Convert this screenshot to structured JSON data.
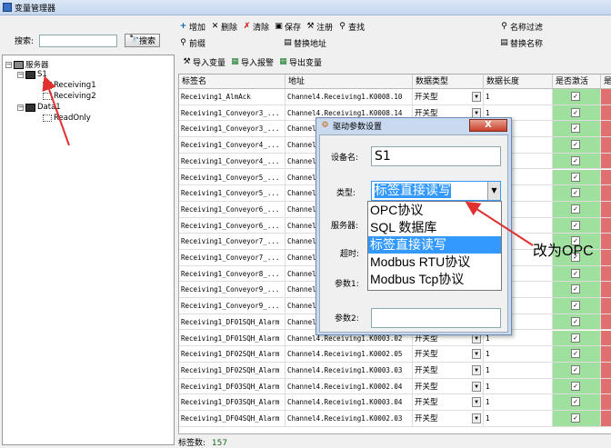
{
  "window": {
    "title": "变量管理器"
  },
  "left": {
    "search_label": "搜索:",
    "search_value": "",
    "search_button": "搜索",
    "tree": [
      {
        "label": "服务器",
        "type": "server"
      },
      {
        "label": "S1",
        "type": "device"
      },
      {
        "label": "Receiving1",
        "type": "var"
      },
      {
        "label": "Receiving2",
        "type": "var"
      },
      {
        "label": "Data1",
        "type": "device"
      },
      {
        "label": "ReadOnly",
        "type": "var"
      }
    ]
  },
  "toolbar": {
    "row1": [
      "增加",
      "删除",
      "清除",
      "保存",
      "注册",
      "查找"
    ],
    "row1_right": "名称过滤",
    "row2_left": "前缀",
    "row2_mid": "替换地址",
    "row2_right": "替换名称",
    "row3": [
      "导入变量",
      "导入报警",
      "导出变量"
    ]
  },
  "grid": {
    "columns": [
      "标签名",
      "地址",
      "数据类型",
      "数据长度",
      "是否激活",
      "是"
    ],
    "rows": [
      {
        "name": "Receiving1_AlmAck",
        "address": "Channel4.Receiving1.K0008.10",
        "dtype": "开关型",
        "len": "1",
        "active": true
      },
      {
        "name": "Receiving1_Conveyor3_...",
        "address": "Channel4.Receiving1.K0008.14",
        "dtype": "开关型",
        "len": "1",
        "active": true
      },
      {
        "name": "Receiving1_Conveyor3_...",
        "address": "Channel4",
        "dtype": "",
        "len": "",
        "active": true
      },
      {
        "name": "Receiving1_Conveyor4_...",
        "address": "Channel4",
        "dtype": "",
        "len": "",
        "active": true
      },
      {
        "name": "Receiving1_Conveyor4_...",
        "address": "Channel4",
        "dtype": "",
        "len": "",
        "active": true
      },
      {
        "name": "Receiving1_Conveyor5_...",
        "address": "Channel4",
        "dtype": "",
        "len": "",
        "active": true
      },
      {
        "name": "Receiving1_Conveyor5_...",
        "address": "Channel4",
        "dtype": "",
        "len": "",
        "active": true
      },
      {
        "name": "Receiving1_Conveyor6_...",
        "address": "Channel4",
        "dtype": "",
        "len": "",
        "active": true
      },
      {
        "name": "Receiving1_Conveyor6_...",
        "address": "Channel4",
        "dtype": "",
        "len": "",
        "active": true
      },
      {
        "name": "Receiving1_Conveyor7_...",
        "address": "Channel4",
        "dtype": "",
        "len": "",
        "active": true
      },
      {
        "name": "Receiving1_Conveyor7_...",
        "address": "Channel4",
        "dtype": "",
        "len": "",
        "active": true
      },
      {
        "name": "Receiving1_Conveyor8_...",
        "address": "Channel4",
        "dtype": "",
        "len": "",
        "active": true
      },
      {
        "name": "Receiving1_Conveyor9_...",
        "address": "Channel4",
        "dtype": "",
        "len": "",
        "active": true
      },
      {
        "name": "Receiving1_Conveyor9_...",
        "address": "Channel4",
        "dtype": "",
        "len": "",
        "active": true
      },
      {
        "name": "Receiving1_DF01SQH_Alarm",
        "address": "Channel4",
        "dtype": "",
        "len": "",
        "active": true
      },
      {
        "name": "Receiving1_DF01SQH_Alarm",
        "address": "Channel4.Receiving1.K0003.02",
        "dtype": "开关型",
        "len": "1",
        "active": true
      },
      {
        "name": "Receiving1_DF02SQH_Alarm",
        "address": "Channel4.Receiving1.K0002.05",
        "dtype": "开关型",
        "len": "1",
        "active": true
      },
      {
        "name": "Receiving1_DF02SQH_Alarm",
        "address": "Channel4.Receiving1.K0003.03",
        "dtype": "开关型",
        "len": "1",
        "active": true
      },
      {
        "name": "Receiving1_DF03SQH_Alarm",
        "address": "Channel4.Receiving1.K0002.04",
        "dtype": "开关型",
        "len": "1",
        "active": true
      },
      {
        "name": "Receiving1_DF03SQH_Alarm",
        "address": "Channel4.Receiving1.K0003.04",
        "dtype": "开关型",
        "len": "1",
        "active": true
      },
      {
        "name": "Receiving1_DF04SQH_Alarm",
        "address": "Channel4.Receiving1.K0002.03",
        "dtype": "开关型",
        "len": "1",
        "active": true
      }
    ],
    "status_label": "标签数:",
    "status_count": "157"
  },
  "dialog": {
    "title": "驱动参数设置",
    "close": "X",
    "device_label": "设备名:",
    "device_value": "S1",
    "type_label": "类型:",
    "type_value": "标签直接读写",
    "server_label": "服务器:",
    "timeout_label": "超时:",
    "param1_label": "参数1:",
    "param2_label": "参数2:",
    "options": [
      "OPC协议",
      "SQL 数据库",
      "标签直接读写",
      "Modbus RTU协议",
      "Modbus Tcp协议"
    ],
    "highlighted": 2
  },
  "annotation": "改为OPC",
  "colors": {
    "active_col": "#9fe09f",
    "red_col": "#e07070",
    "highlight": "#3399ff",
    "arrow": "#e03030"
  }
}
